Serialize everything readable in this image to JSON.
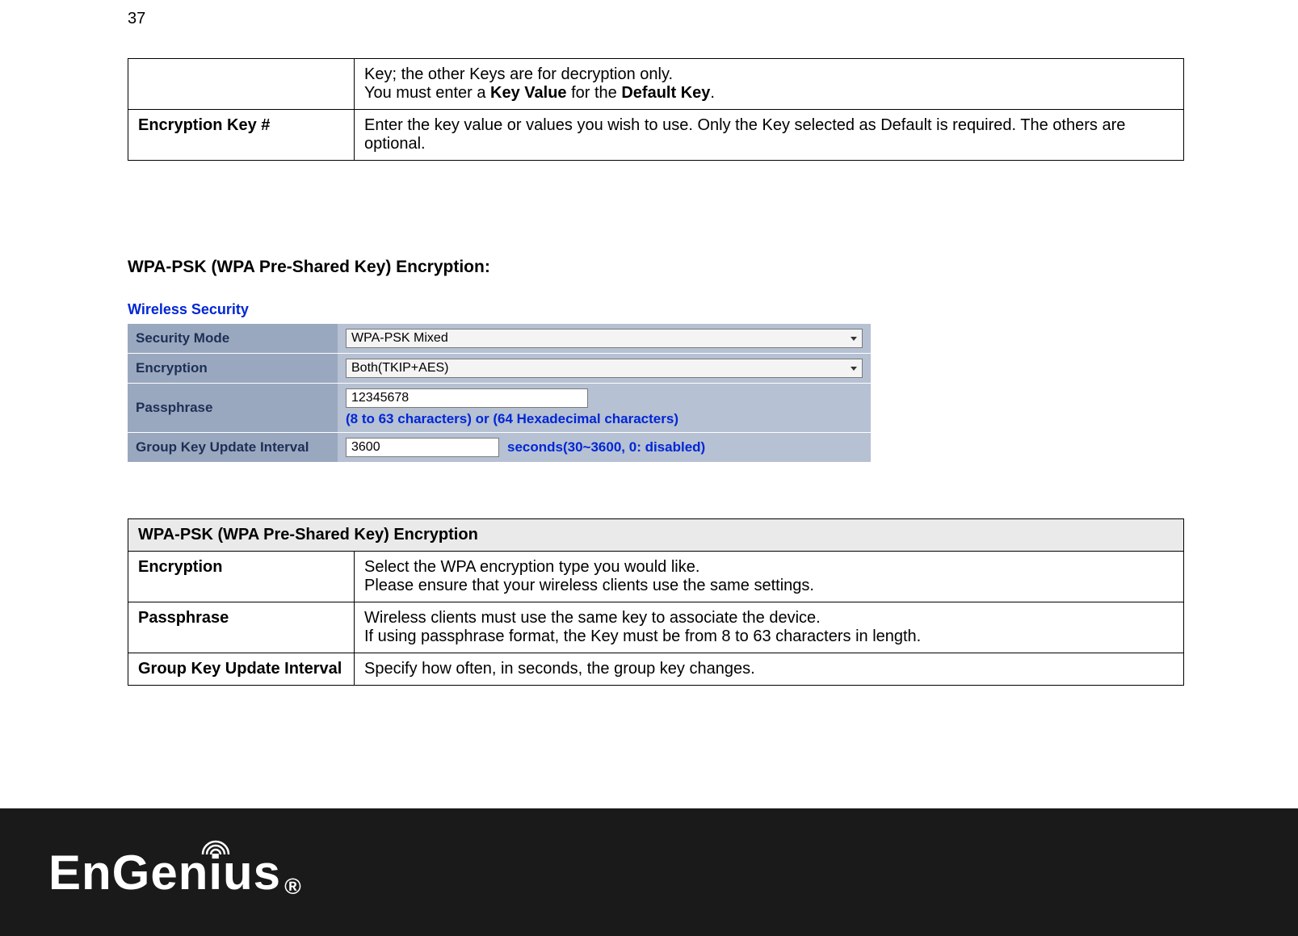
{
  "page_number": "37",
  "table1": {
    "row1": {
      "label": "",
      "text_a": "Key; the other Keys are for decryption only.",
      "text_b_pre": "You must enter a ",
      "text_b_bold1": "Key Value",
      "text_b_mid": " for the ",
      "text_b_bold2": "Default Key",
      "text_b_post": "."
    },
    "row2": {
      "label": "Encryption Key #",
      "text": "Enter the key value or values you wish to use. Only the Key selected as Default is required. The others are optional."
    }
  },
  "section_heading": "WPA-PSK (WPA Pre-Shared Key) Encryption:",
  "form": {
    "title": "Wireless Security",
    "security_mode": {
      "label": "Security Mode",
      "value": "WPA-PSK Mixed"
    },
    "encryption": {
      "label": "Encryption",
      "value": "Both(TKIP+AES)"
    },
    "passphrase": {
      "label": "Passphrase",
      "value": "12345678",
      "hint": "(8 to 63 characters) or (64 Hexadecimal characters)"
    },
    "interval": {
      "label": "Group Key Update Interval",
      "value": "3600",
      "hint": "seconds(30~3600, 0: disabled)"
    }
  },
  "table2": {
    "header": "WPA-PSK (WPA Pre-Shared Key) Encryption",
    "row1": {
      "label": "Encryption",
      "line1": "Select the WPA encryption type you would like.",
      "line2": "Please ensure that your wireless clients use the same settings."
    },
    "row2": {
      "label": "Passphrase",
      "line1": "Wireless clients must use the same key to associate the device.",
      "line2": "If using passphrase format, the Key must be from 8 to 63 characters in length."
    },
    "row3": {
      "label": "Group Key Update Interval",
      "line1": "Specify how often, in seconds, the group key changes."
    }
  },
  "logo": {
    "text_a": "EnGen",
    "text_i": "i",
    "text_b": "us",
    "reg": "®"
  }
}
